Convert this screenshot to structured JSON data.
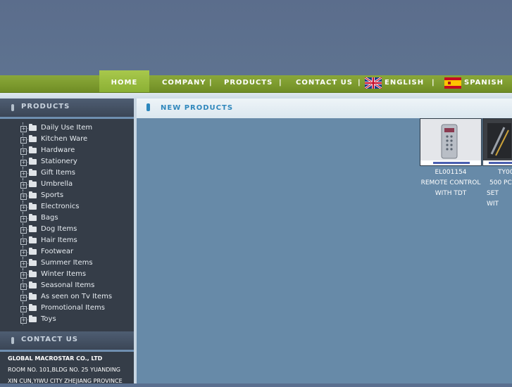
{
  "nav": {
    "home": "HOME",
    "company": "COMPANY",
    "products": "PRODUCTS",
    "contact": "CONTACT US",
    "english": "ENGLISH",
    "spanish": "SPANISH",
    "separator": "|"
  },
  "sidebar": {
    "products_title": "PRODUCTS",
    "categories": [
      "Daily Use Item",
      "Kitchen Ware",
      "Hardware",
      "Stationery",
      "Gift Items",
      "Umbrella",
      "Sports",
      "Electronics",
      "Bags",
      "Dog Items",
      "Hair Items",
      "Footwear",
      "Summer Items",
      "Winter Items",
      "Seasonal Items",
      "As seen on Tv Items",
      "Promotional Items",
      "Toys"
    ],
    "contact_title": "CONTACT US",
    "contact_company": "GLOBAL MACROSTAR CO., LTD",
    "contact_line1": "ROOM NO. 101,BLDG NO. 25 YUANDING",
    "contact_line2": "XIN CUN,YIWU CITY ZHEJIANG PROVINCE"
  },
  "main": {
    "title": "NEW PRODUCTS",
    "products": [
      {
        "code": "EL001154",
        "line1": "REMOTE CONTROL",
        "line2": "WITH TDT"
      },
      {
        "code": "TY00",
        "line1": "500 PC",
        "line2": "SET WIT"
      }
    ]
  },
  "colors": {
    "nav_green": "#7e9c2f",
    "sidebar_bg": "#353d48",
    "main_bg": "#678aa8",
    "accent_blue": "#2f87bc"
  }
}
